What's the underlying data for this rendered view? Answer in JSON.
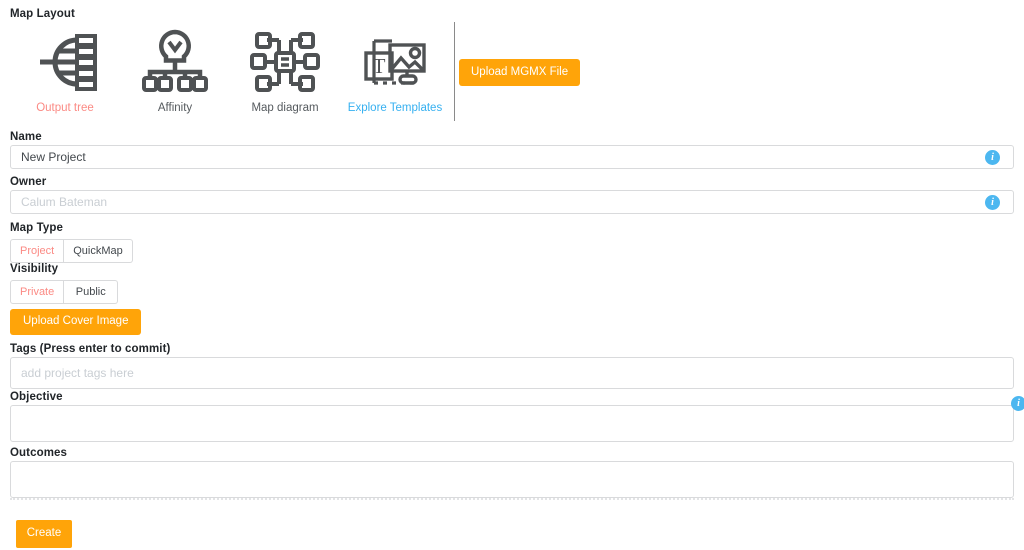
{
  "map_layout": {
    "section_label": "Map Layout",
    "options": [
      {
        "label": "Output tree",
        "icon": "output-tree-icon",
        "state": "selected"
      },
      {
        "label": "Affinity",
        "icon": "affinity-icon",
        "state": "normal"
      },
      {
        "label": "Map diagram",
        "icon": "map-diagram-icon",
        "state": "normal"
      },
      {
        "label": "Explore Templates",
        "icon": "explore-templates-icon",
        "state": "link"
      }
    ],
    "upload_mgmx_label": "Upload MGMX File"
  },
  "form": {
    "name": {
      "label": "Name",
      "value": "New Project",
      "placeholder": "",
      "info": "i"
    },
    "owner": {
      "label": "Owner",
      "value": "",
      "placeholder": "Calum Bateman",
      "info": "i"
    },
    "map_type": {
      "label": "Map Type",
      "options": [
        "Project",
        "QuickMap"
      ],
      "selected": "Project"
    },
    "visibility": {
      "label": "Visibility",
      "options": [
        "Private",
        "Public"
      ],
      "selected": "Private"
    },
    "upload_cover_label": "Upload Cover Image",
    "tags": {
      "label": "Tags (Press enter to commit)",
      "value": "",
      "placeholder": "add project tags here"
    },
    "objective": {
      "label": "Objective",
      "value": "",
      "placeholder": "",
      "info": "i"
    },
    "outcomes": {
      "label": "Outcomes",
      "value": "",
      "placeholder": ""
    },
    "create_label": "Create"
  },
  "colors": {
    "orange": "#ffa409",
    "selected_text": "#fb8a84",
    "link": "#36b0f0",
    "info_badge": "#4cb7f0",
    "icon_gray": "#4f5254",
    "border": "#d9dadc"
  }
}
